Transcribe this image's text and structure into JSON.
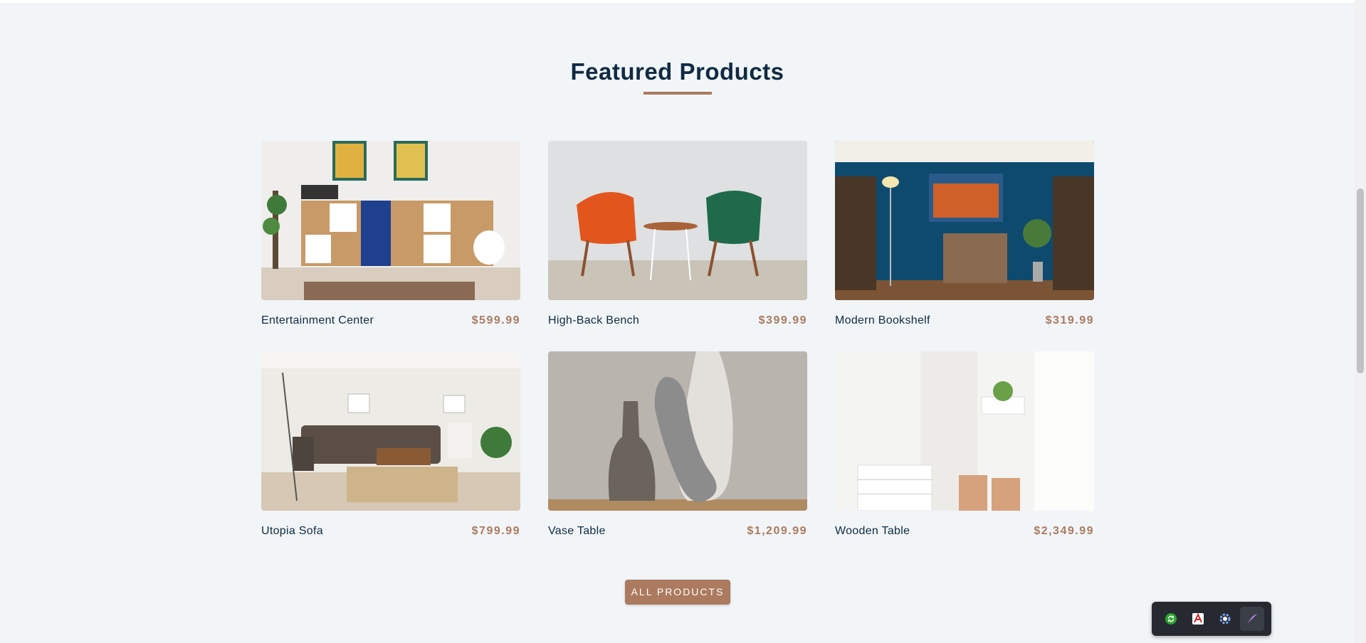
{
  "section": {
    "title": "Featured Products"
  },
  "products": [
    {
      "name": "Entertainment Center",
      "price": "$599.99"
    },
    {
      "name": "High-Back Bench",
      "price": "$399.99"
    },
    {
      "name": "Modern Bookshelf",
      "price": "$319.99"
    },
    {
      "name": "Utopia Sofa",
      "price": "$799.99"
    },
    {
      "name": "Vase Table",
      "price": "$1,209.99"
    },
    {
      "name": "Wooden Table",
      "price": "$2,349.99"
    }
  ],
  "cta": {
    "label": "All Products"
  },
  "colors": {
    "accent": "#ab7a5f",
    "heading": "#102a42",
    "background": "#f1f5f8"
  },
  "extension_toolbar": {
    "icons": [
      "sync-icon",
      "pdf-icon",
      "settings-gear-icon",
      "feather-pen-icon"
    ]
  }
}
